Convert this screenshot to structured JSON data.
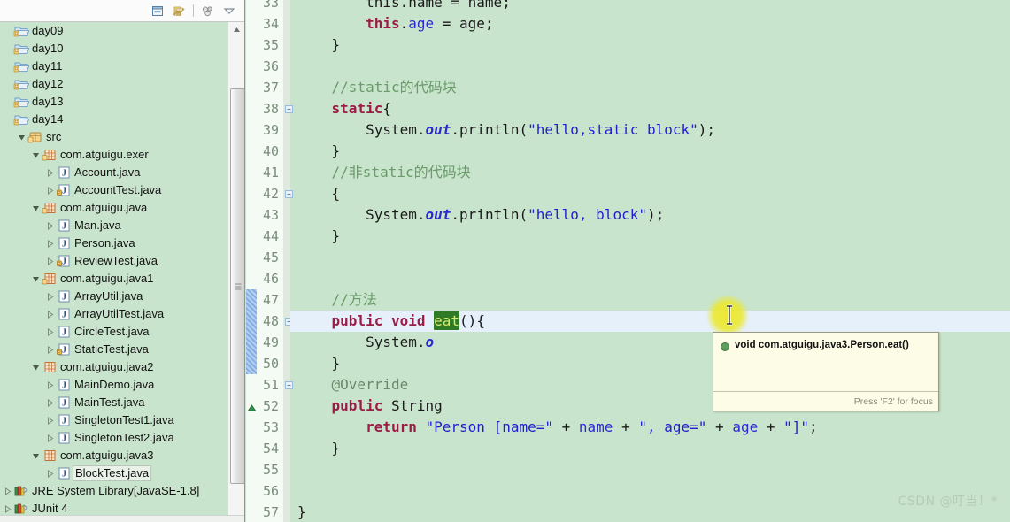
{
  "explorer": {
    "toolbar": [
      {
        "name": "collapse-all-icon",
        "title": "Collapse All"
      },
      {
        "name": "link-with-editor-icon",
        "title": "Link with Editor"
      },
      {
        "name": "view-menu-icon",
        "title": "View Menu"
      },
      {
        "name": "chevron-down-icon",
        "title": "Minimize"
      }
    ],
    "tree": [
      {
        "label": "day09",
        "icon": "project-folder-icon",
        "indent": 0,
        "arrow": "none",
        "selected": false
      },
      {
        "label": "day10",
        "icon": "project-folder-icon",
        "indent": 0,
        "arrow": "none",
        "selected": false
      },
      {
        "label": "day11",
        "icon": "project-folder-icon",
        "indent": 0,
        "arrow": "none",
        "selected": false
      },
      {
        "label": "day12",
        "icon": "project-folder-icon",
        "indent": 0,
        "arrow": "none",
        "selected": false
      },
      {
        "label": "day13",
        "icon": "project-folder-icon",
        "indent": 0,
        "arrow": "none",
        "selected": false
      },
      {
        "label": "day14",
        "icon": "project-folder-icon",
        "indent": 0,
        "arrow": "none",
        "selected": false
      },
      {
        "label": "src",
        "icon": "source-folder-icon",
        "indent": 1,
        "arrow": "expanded",
        "selected": false
      },
      {
        "label": "com.atguigu.exer",
        "icon": "package-icon",
        "indent": 2,
        "arrow": "expanded",
        "selected": false
      },
      {
        "label": "Account.java",
        "icon": "java-file-icon",
        "indent": 3,
        "arrow": "collapsed",
        "selected": false
      },
      {
        "label": "AccountTest.java",
        "icon": "java-file-main-icon",
        "indent": 3,
        "arrow": "collapsed",
        "selected": false
      },
      {
        "label": "com.atguigu.java",
        "icon": "package-icon",
        "indent": 2,
        "arrow": "expanded",
        "selected": false
      },
      {
        "label": "Man.java",
        "icon": "java-file-icon",
        "indent": 3,
        "arrow": "collapsed",
        "selected": false
      },
      {
        "label": "Person.java",
        "icon": "java-file-icon",
        "indent": 3,
        "arrow": "collapsed",
        "selected": false
      },
      {
        "label": "ReviewTest.java",
        "icon": "java-file-main-icon",
        "indent": 3,
        "arrow": "collapsed",
        "selected": false
      },
      {
        "label": "com.atguigu.java1",
        "icon": "package-icon",
        "indent": 2,
        "arrow": "expanded",
        "selected": false
      },
      {
        "label": "ArrayUtil.java",
        "icon": "java-file-icon",
        "indent": 3,
        "arrow": "collapsed",
        "selected": false
      },
      {
        "label": "ArrayUtilTest.java",
        "icon": "java-file-icon",
        "indent": 3,
        "arrow": "collapsed",
        "selected": false
      },
      {
        "label": "CircleTest.java",
        "icon": "java-file-icon",
        "indent": 3,
        "arrow": "collapsed",
        "selected": false
      },
      {
        "label": "StaticTest.java",
        "icon": "java-file-main-icon",
        "indent": 3,
        "arrow": "collapsed",
        "selected": false
      },
      {
        "label": "com.atguigu.java2",
        "icon": "package-plain-icon",
        "indent": 2,
        "arrow": "expanded",
        "selected": false
      },
      {
        "label": "MainDemo.java",
        "icon": "java-file-icon",
        "indent": 3,
        "arrow": "collapsed",
        "selected": false
      },
      {
        "label": "MainTest.java",
        "icon": "java-file-icon",
        "indent": 3,
        "arrow": "collapsed",
        "selected": false
      },
      {
        "label": "SingletonTest1.java",
        "icon": "java-file-icon",
        "indent": 3,
        "arrow": "collapsed",
        "selected": false
      },
      {
        "label": "SingletonTest2.java",
        "icon": "java-file-icon",
        "indent": 3,
        "arrow": "collapsed",
        "selected": false
      },
      {
        "label": "com.atguigu.java3",
        "icon": "package-plain-icon",
        "indent": 2,
        "arrow": "expanded",
        "selected": false
      },
      {
        "label": "BlockTest.java",
        "icon": "java-file-icon",
        "indent": 3,
        "arrow": "collapsed",
        "selected": true
      },
      {
        "label": "JRE System Library",
        "suffix": " [JavaSE-1.8]",
        "icon": "library-icon",
        "indent": 0,
        "arrow": "collapsed",
        "selected": false
      },
      {
        "label": "JUnit 4",
        "icon": "library-icon",
        "indent": 0,
        "arrow": "collapsed",
        "selected": false
      }
    ]
  },
  "editor": {
    "first_line": 34,
    "current_line": 48,
    "partial_top_line": "        this.name = name;",
    "lines": [
      {
        "n": 34,
        "fold": false,
        "marker": "",
        "tokens": [
          {
            "t": "        ",
            "c": "p"
          },
          {
            "t": "this",
            "c": "k"
          },
          {
            "t": ".",
            "c": "p"
          },
          {
            "t": "age",
            "c": "f"
          },
          {
            "t": " = age;",
            "c": "p"
          }
        ]
      },
      {
        "n": 35,
        "fold": false,
        "marker": "",
        "tokens": [
          {
            "t": "    }",
            "c": "p"
          }
        ]
      },
      {
        "n": 36,
        "fold": false,
        "marker": "",
        "tokens": []
      },
      {
        "n": 37,
        "fold": false,
        "marker": "",
        "tokens": [
          {
            "t": "    //static的代码块",
            "c": "c"
          }
        ]
      },
      {
        "n": 38,
        "fold": true,
        "marker": "",
        "tokens": [
          {
            "t": "    ",
            "c": "p"
          },
          {
            "t": "static",
            "c": "k"
          },
          {
            "t": "{",
            "c": "p"
          }
        ]
      },
      {
        "n": 39,
        "fold": false,
        "marker": "",
        "tokens": [
          {
            "t": "        System.",
            "c": "p"
          },
          {
            "t": "out",
            "c": "fs"
          },
          {
            "t": ".println(",
            "c": "p"
          },
          {
            "t": "\"hello,static block\"",
            "c": "s"
          },
          {
            "t": ");",
            "c": "p"
          }
        ]
      },
      {
        "n": 40,
        "fold": false,
        "marker": "",
        "tokens": [
          {
            "t": "    }",
            "c": "p"
          }
        ]
      },
      {
        "n": 41,
        "fold": false,
        "marker": "",
        "tokens": [
          {
            "t": "    //非static的代码块",
            "c": "c"
          }
        ]
      },
      {
        "n": 42,
        "fold": true,
        "marker": "",
        "tokens": [
          {
            "t": "    {",
            "c": "p"
          }
        ]
      },
      {
        "n": 43,
        "fold": false,
        "marker": "",
        "tokens": [
          {
            "t": "        System.",
            "c": "p"
          },
          {
            "t": "out",
            "c": "fs"
          },
          {
            "t": ".println(",
            "c": "p"
          },
          {
            "t": "\"hello, block\"",
            "c": "s"
          },
          {
            "t": ");",
            "c": "p"
          }
        ]
      },
      {
        "n": 44,
        "fold": false,
        "marker": "",
        "tokens": [
          {
            "t": "    }",
            "c": "p"
          }
        ]
      },
      {
        "n": 45,
        "fold": false,
        "marker": "",
        "tokens": []
      },
      {
        "n": 46,
        "fold": false,
        "marker": "",
        "tokens": []
      },
      {
        "n": 47,
        "fold": false,
        "marker": "",
        "tokens": [
          {
            "t": "    //方法",
            "c": "c"
          }
        ]
      },
      {
        "n": 48,
        "fold": true,
        "marker": "",
        "tokens": [
          {
            "t": "    ",
            "c": "p"
          },
          {
            "t": "public",
            "c": "k"
          },
          {
            "t": " ",
            "c": "p"
          },
          {
            "t": "void",
            "c": "k"
          },
          {
            "t": " ",
            "c": "p"
          },
          {
            "t": "eat",
            "c": "hlword"
          },
          {
            "t": "(){",
            "c": "p"
          }
        ]
      },
      {
        "n": 49,
        "fold": false,
        "marker": "",
        "tokens": [
          {
            "t": "        System.",
            "c": "p"
          },
          {
            "t": "o",
            "c": "fs"
          }
        ]
      },
      {
        "n": 50,
        "fold": false,
        "marker": "",
        "tokens": [
          {
            "t": "    }",
            "c": "p"
          }
        ]
      },
      {
        "n": 51,
        "fold": true,
        "marker": "",
        "tokens": [
          {
            "t": "    @Override",
            "c": "a"
          }
        ]
      },
      {
        "n": 52,
        "fold": false,
        "marker": "override",
        "tokens": [
          {
            "t": "    ",
            "c": "p"
          },
          {
            "t": "public",
            "c": "k"
          },
          {
            "t": " String",
            "c": "p"
          }
        ]
      },
      {
        "n": 53,
        "fold": false,
        "marker": "",
        "tokens": [
          {
            "t": "        ",
            "c": "p"
          },
          {
            "t": "return",
            "c": "k"
          },
          {
            "t": " ",
            "c": "p"
          },
          {
            "t": "\"Person [name=\"",
            "c": "s"
          },
          {
            "t": " + ",
            "c": "p"
          },
          {
            "t": "name",
            "c": "f"
          },
          {
            "t": " + ",
            "c": "p"
          },
          {
            "t": "\", age=\"",
            "c": "s"
          },
          {
            "t": " + ",
            "c": "p"
          },
          {
            "t": "age",
            "c": "f"
          },
          {
            "t": " + ",
            "c": "p"
          },
          {
            "t": "\"]\"",
            "c": "s"
          },
          {
            "t": ";",
            "c": "p"
          }
        ]
      },
      {
        "n": 54,
        "fold": false,
        "marker": "",
        "tokens": [
          {
            "t": "    }",
            "c": "p"
          }
        ]
      },
      {
        "n": 55,
        "fold": false,
        "marker": "",
        "tokens": []
      },
      {
        "n": 56,
        "fold": false,
        "marker": "",
        "tokens": []
      },
      {
        "n": 57,
        "fold": false,
        "marker": "",
        "tokens": [
          {
            "t": "}",
            "c": "p"
          }
        ]
      }
    ]
  },
  "tooltip": {
    "signature": "void com.atguigu.java3.Person.eat()",
    "footer": "Press 'F2' for focus"
  },
  "watermark": "CSDN @叮当！*",
  "colors": {
    "editor_background": "#c9e4cc",
    "gutter_background": "#f4faf4",
    "current_line": "#e6f0fb",
    "highlight_word_bg": "#2f7a24",
    "highlight_word_fg": "#d8e870",
    "tooltip_background": "#fdfce6",
    "keyword": "#9b1d47",
    "string": "#2020d0",
    "comment": "#6a9b6a",
    "mouse_halo": "#ece828"
  }
}
